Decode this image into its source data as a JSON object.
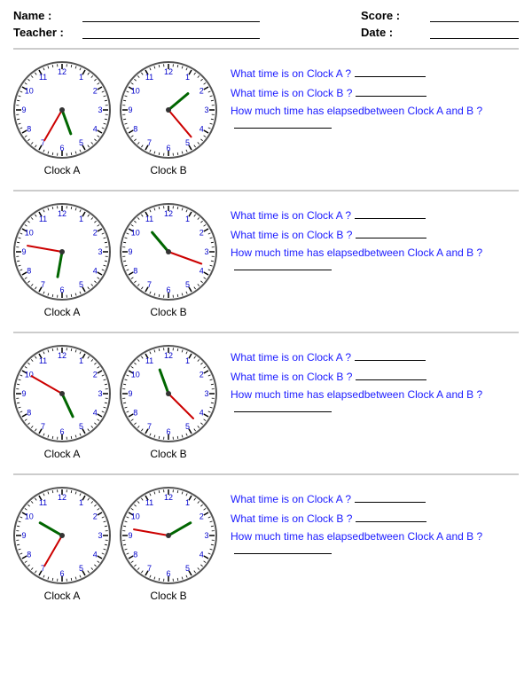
{
  "header": {
    "name_label": "Name :",
    "teacher_label": "Teacher :",
    "score_label": "Score :",
    "date_label": "Date :"
  },
  "rows": [
    {
      "id": 1,
      "clockA_label": "Clock A",
      "clockB_label": "Clock B",
      "q1": "What time is on Clock A ?",
      "q2": "What time is on Clock B ?",
      "q3": "How much time has elapsed",
      "q3b": "between Clock A and B ?",
      "clockA": {
        "hour_angle": 160,
        "min_angle": 210
      },
      "clockB": {
        "hour_angle": 50,
        "min_angle": 140
      }
    },
    {
      "id": 2,
      "clockA_label": "Clock A",
      "clockB_label": "Clock B",
      "q1": "What time is on Clock A ?",
      "q2": "What time is on Clock B ?",
      "q3": "How much time has elapsed",
      "q3b": "between Clock A and B ?",
      "clockA": {
        "hour_angle": 190,
        "min_angle": 280
      },
      "clockB": {
        "hour_angle": 320,
        "min_angle": 110
      }
    },
    {
      "id": 3,
      "clockA_label": "Clock A",
      "clockB_label": "Clock B",
      "q1": "What time is on Clock A ?",
      "q2": "What time is on Clock B ?",
      "q3": "How much time has elapsed",
      "q3b": "between Clock A and B ?",
      "clockA": {
        "hour_angle": 155,
        "min_angle": 300
      },
      "clockB": {
        "hour_angle": 340,
        "min_angle": 135
      }
    },
    {
      "id": 4,
      "clockA_label": "Clock A",
      "clockB_label": "Clock B",
      "q1": "What time is on Clock A ?",
      "q2": "What time is on Clock B ?",
      "q3": "How much time has elapsed",
      "q3b": "between Clock A and B ?",
      "clockA": {
        "hour_angle": 300,
        "min_angle": 210
      },
      "clockB": {
        "hour_angle": 60,
        "min_angle": 280
      }
    }
  ]
}
